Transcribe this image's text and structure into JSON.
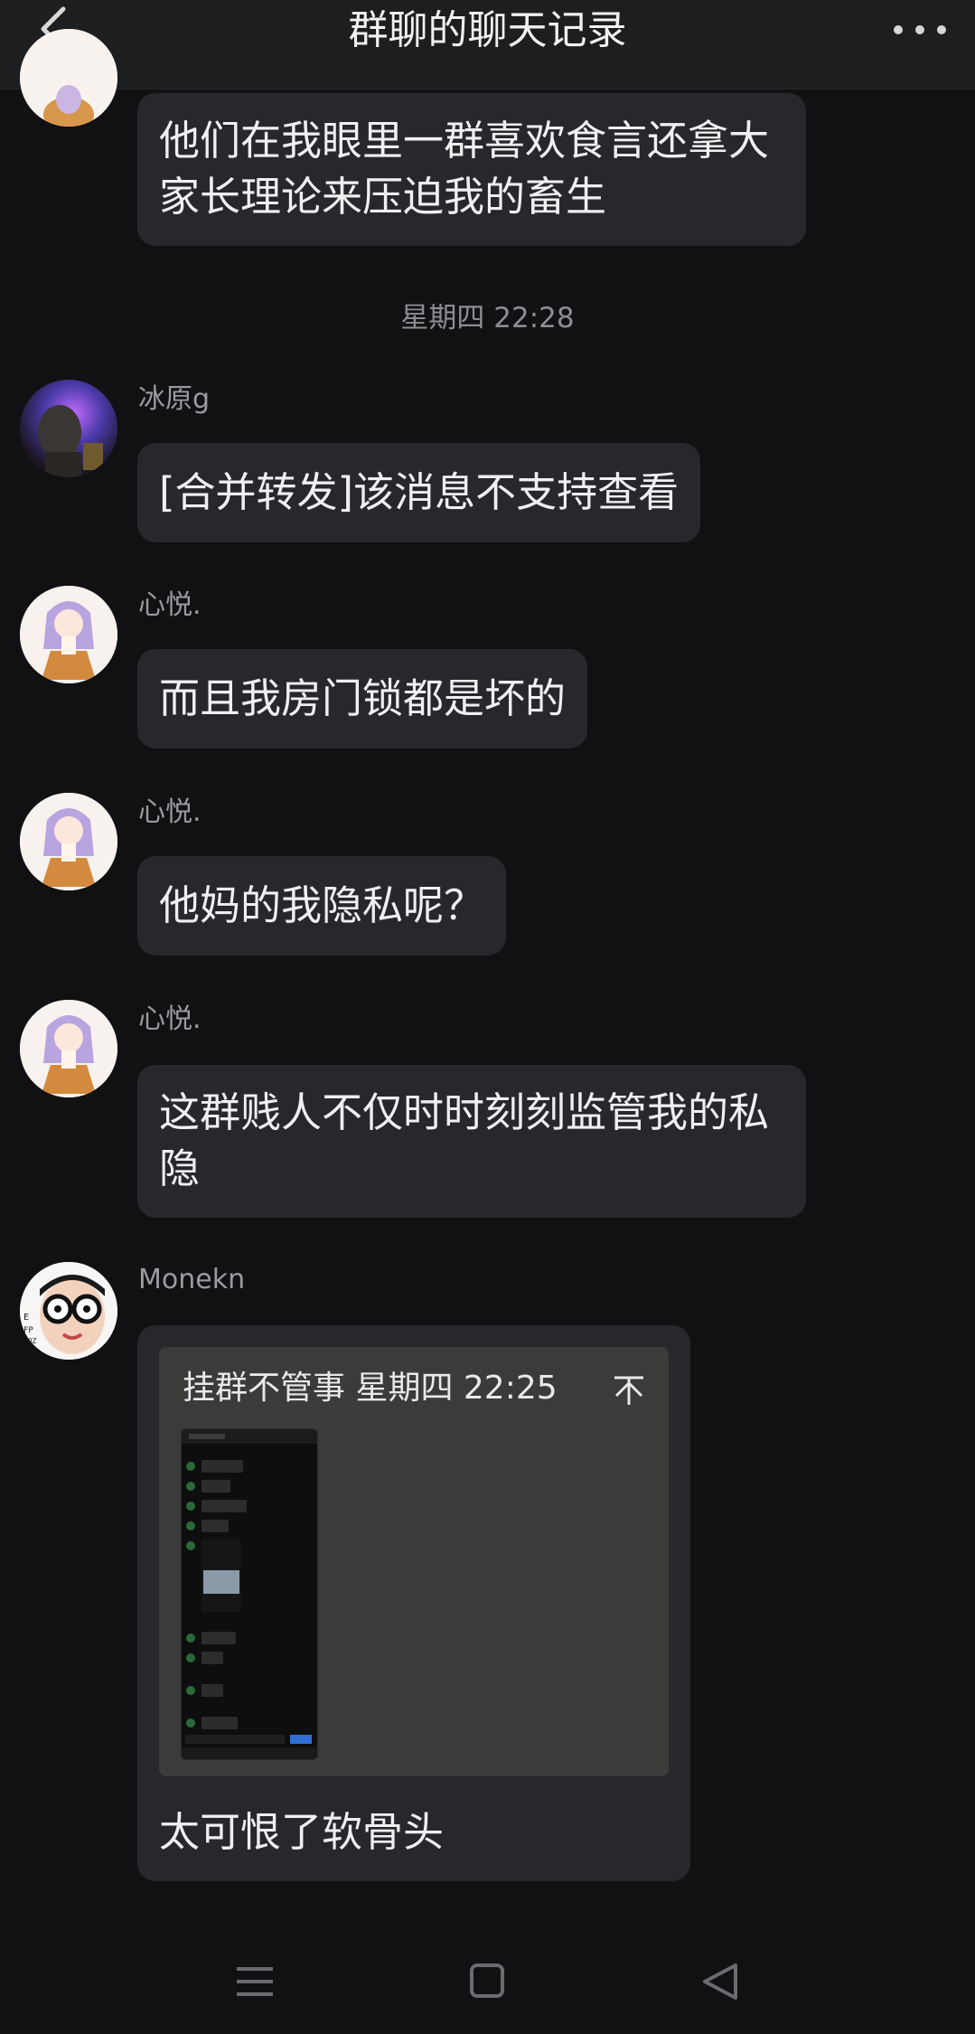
{
  "header": {
    "back_icon": "chevron-left-icon",
    "title": "群聊的聊天记录",
    "more_icon": "more-dots-icon"
  },
  "messages": [
    {
      "sender": "",
      "text": "他们在我眼里一群喜欢食言还拿大家长理论来压迫我的畜生",
      "lines": [
        "他们在我眼里一群喜欢食言还拿大",
        "家长理论来压迫我的畜生"
      ]
    },
    {
      "sender": "冰原g",
      "text": "[合并转发]该消息不支持查看"
    },
    {
      "sender": "心悦.",
      "text": "而且我房门锁都是坏的"
    },
    {
      "sender": "心悦.",
      "text": "他妈的我隐私呢？"
    },
    {
      "sender": "心悦.",
      "text": "这群贱人不仅时时刻刻监管我的私隐",
      "lines": [
        "这群贱人不仅时时刻刻监管我的私",
        "隐"
      ]
    },
    {
      "sender": "Monekn",
      "quote": {
        "header": "挂群不管事 星期四 22:25",
        "jump_icon": "jump-to-top-icon",
        "thumbnail": "chat-screenshot-thumbnail"
      },
      "text": "太可恨了软骨头"
    }
  ],
  "timestamp": "星期四 22:28",
  "navbar": {
    "menu_icon": "menu-icon",
    "home_icon": "home-square-icon",
    "back_icon": "back-triangle-icon"
  },
  "colors": {
    "background": "#111113",
    "bubble": "#27282c",
    "header": "#1d1e20",
    "quote_card": "#3b3b39"
  }
}
